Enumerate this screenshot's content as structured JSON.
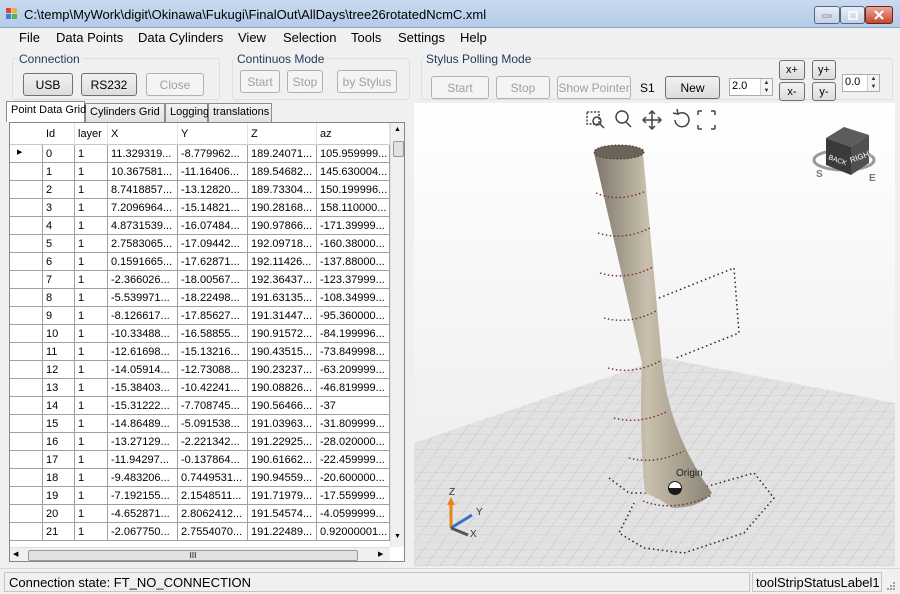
{
  "window": {
    "title": "C:\\temp\\MyWork\\digit\\Okinawa\\Fukugi\\FinalOut\\AllDays\\tree26rotatedNcmC.xml"
  },
  "menu": [
    "File",
    "Data Points",
    "Data Cylinders",
    "View",
    "Selection",
    "Tools",
    "Settings",
    "Help"
  ],
  "connection": {
    "label": "Connection",
    "usb": "USB",
    "rs232": "RS232",
    "close": "Close"
  },
  "continuous": {
    "label": "Continuos Mode",
    "start": "Start",
    "stop": "Stop",
    "by_stylus": "by Stylus"
  },
  "stylus": {
    "label": "Stylus Polling Mode",
    "start": "Start",
    "stop": "Stop",
    "show_pointer": "Show Pointer",
    "s1": "S1",
    "new": "New",
    "spin_value": "2.0",
    "x_plus": "x+",
    "x_minus": "x-",
    "y_plus": "y+",
    "y_minus": "y-",
    "spin2_value": "0.0"
  },
  "tabs": [
    "Point Data Grid",
    "Cylinders Grid",
    "Logging",
    "translations"
  ],
  "grid": {
    "columns": [
      "Id",
      "layer",
      "X",
      "Y",
      "Z",
      "az"
    ],
    "rows": [
      [
        "0",
        "1",
        "11.329319...",
        "-8.779962...",
        "189.24071...",
        "105.959999..."
      ],
      [
        "1",
        "1",
        "10.367581...",
        "-11.16406...",
        "189.54682...",
        "145.630004..."
      ],
      [
        "2",
        "1",
        "8.7418857...",
        "-13.12820...",
        "189.73304...",
        "150.199996..."
      ],
      [
        "3",
        "1",
        "7.2096964...",
        "-15.14821...",
        "190.28168...",
        "158.110000..."
      ],
      [
        "4",
        "1",
        "4.8731539...",
        "-16.07484...",
        "190.97866...",
        "-171.39999..."
      ],
      [
        "5",
        "1",
        "2.7583065...",
        "-17.09442...",
        "192.09718...",
        "-160.38000..."
      ],
      [
        "6",
        "1",
        "0.1591665...",
        "-17.62871...",
        "192.11426...",
        "-137.88000..."
      ],
      [
        "7",
        "1",
        "-2.366026...",
        "-18.00567...",
        "192.36437...",
        "-123.37999..."
      ],
      [
        "8",
        "1",
        "-5.539971...",
        "-18.22498...",
        "191.63135...",
        "-108.34999..."
      ],
      [
        "9",
        "1",
        "-8.126617...",
        "-17.85627...",
        "191.31447...",
        "-95.360000..."
      ],
      [
        "10",
        "1",
        "-10.33488...",
        "-16.58855...",
        "190.91572...",
        "-84.199996..."
      ],
      [
        "11",
        "1",
        "-12.61698...",
        "-15.13216...",
        "190.43515...",
        "-73.849998..."
      ],
      [
        "12",
        "1",
        "-14.05914...",
        "-12.73088...",
        "190.23237...",
        "-63.209999..."
      ],
      [
        "13",
        "1",
        "-15.38403...",
        "-10.42241...",
        "190.08826...",
        "-46.819999..."
      ],
      [
        "14",
        "1",
        "-15.31222...",
        "-7.708745...",
        "190.56466...",
        "-37"
      ],
      [
        "15",
        "1",
        "-14.86489...",
        "-5.091538...",
        "191.03963...",
        "-31.809999..."
      ],
      [
        "16",
        "1",
        "-13.27129...",
        "-2.221342...",
        "191.22925...",
        "-28.020000..."
      ],
      [
        "17",
        "1",
        "-11.94297...",
        "-0.137864...",
        "190.61662...",
        "-22.459999..."
      ],
      [
        "18",
        "1",
        "-9.483206...",
        "0.7449531...",
        "190.94559...",
        "-20.600000..."
      ],
      [
        "19",
        "1",
        "-7.192155...",
        "2.1548511...",
        "191.71979...",
        "-17.559999..."
      ],
      [
        "20",
        "1",
        "-4.652871...",
        "2.8062412...",
        "191.54574...",
        "-4.0599999..."
      ],
      [
        "21",
        "1",
        "-2.067750...",
        "2.7554070...",
        "191.22489...",
        "0.92000001..."
      ]
    ],
    "hscroll_thumb": "III"
  },
  "viewcube": {
    "right": "RIGHT",
    "back": "BACK",
    "compass_s": "S",
    "compass_e": "E"
  },
  "scene": {
    "origin_label": "Origin",
    "axis_z": "Z",
    "axis_y": "Y",
    "axis_x": "X"
  },
  "status": {
    "connection": "Connection state: FT_NO_CONNECTION",
    "label": "toolStripStatusLabel1"
  }
}
